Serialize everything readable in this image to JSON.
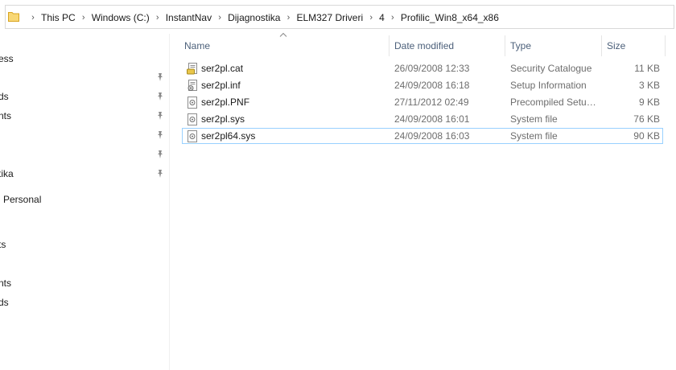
{
  "breadcrumb": [
    "This PC",
    "Windows (C:)",
    "InstantNav",
    "Dijagnostika",
    "ELM327 Driveri",
    "4",
    "Profilic_Win8_x64_x86"
  ],
  "nav_items": [
    "ess",
    "ds",
    "nts",
    "tika",
    "Personal",
    "ts",
    "nts",
    "ds"
  ],
  "columns": {
    "name": "Name",
    "date": "Date modified",
    "type": "Type",
    "size": "Size"
  },
  "files": [
    {
      "name": "ser2pl.cat",
      "date": "26/09/2008 12:33",
      "type": "Security Catalogue",
      "size": "11 KB",
      "icon": "catalog-file-icon"
    },
    {
      "name": "ser2pl.inf",
      "date": "24/09/2008 16:18",
      "type": "Setup Information",
      "size": "3 KB",
      "icon": "setup-info-file-icon"
    },
    {
      "name": "ser2pl.PNF",
      "date": "27/11/2012 02:49",
      "type": "Precompiled Setup Information",
      "size": "9 KB",
      "icon": "system-file-icon"
    },
    {
      "name": "ser2pl.sys",
      "date": "24/09/2008 16:01",
      "type": "System file",
      "size": "76 KB",
      "icon": "system-file-icon"
    },
    {
      "name": "ser2pl64.sys",
      "date": "24/09/2008 16:03",
      "type": "System file",
      "size": "90 KB",
      "icon": "system-file-icon"
    }
  ],
  "colors": {
    "selection_border": "#99d1ff",
    "header_text": "#4c607a",
    "folder_yellow": "#f8d775"
  }
}
